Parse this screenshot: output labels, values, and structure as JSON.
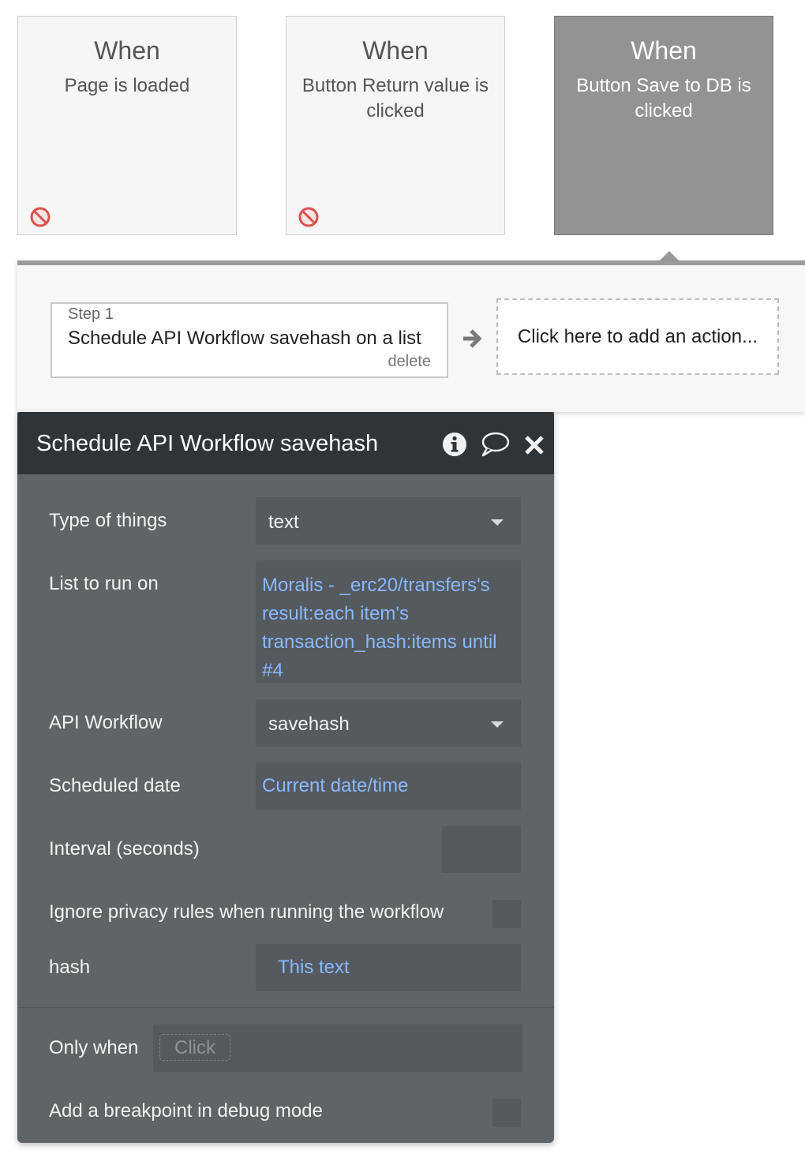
{
  "events": [
    {
      "when": "When",
      "description": "Page is loaded",
      "disabled": true
    },
    {
      "when": "When",
      "description": "Button Return value is clicked",
      "disabled": true
    },
    {
      "when": "When",
      "description": "Button Save to DB is clicked",
      "disabled": false,
      "active": true
    }
  ],
  "actions": {
    "step": {
      "label": "Step 1",
      "title": "Schedule API Workflow savehash on a list",
      "delete_label": "delete"
    },
    "add_action_label": "Click here to add an action..."
  },
  "editor": {
    "title": "Schedule API Workflow savehash",
    "fields": {
      "type_of_things": {
        "label": "Type of things",
        "value": "text"
      },
      "list_to_run_on": {
        "label": "List to run on",
        "value_lines": [
          "Moralis - _erc20/transfers's",
          "result:each item's",
          "transaction_hash:items until",
          "#4"
        ]
      },
      "api_workflow": {
        "label": "API Workflow",
        "value": "savehash"
      },
      "scheduled_date": {
        "label": "Scheduled date",
        "value": "Current date/time"
      },
      "interval": {
        "label": "Interval (seconds)",
        "value": ""
      },
      "ignore_privacy": {
        "label": "Ignore privacy rules when running the workflow",
        "checked": false
      },
      "hash": {
        "label": "hash",
        "value": "This text"
      }
    },
    "only_when": {
      "label": "Only when",
      "placeholder": "Click"
    },
    "breakpoint": {
      "label": "Add a breakpoint in debug mode",
      "checked": false
    }
  },
  "colors": {
    "dynamic_text": "#8ab8ff",
    "panel_bg": "#5f6467",
    "header_bg": "#2f3438",
    "disabled_icon": "#d9534f"
  }
}
